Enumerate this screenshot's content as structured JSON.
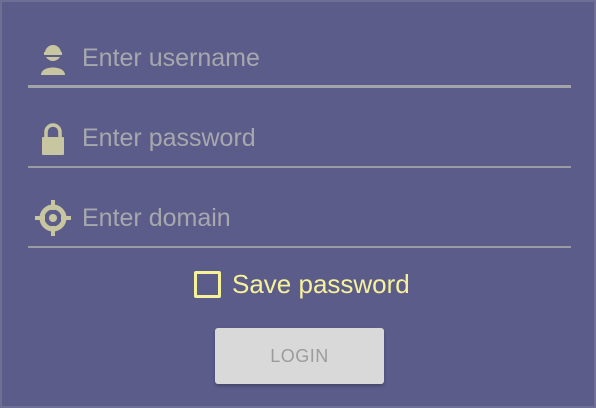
{
  "form": {
    "username": {
      "placeholder": "Enter username",
      "value": "",
      "icon": "user-icon"
    },
    "password": {
      "placeholder": "Enter password",
      "value": "",
      "icon": "lock-icon"
    },
    "domain": {
      "placeholder": "Enter domain",
      "value": "",
      "icon": "crosshair-icon"
    },
    "save_password": {
      "label": "Save password",
      "checked": false
    },
    "login_label": "LOGIN"
  },
  "colors": {
    "background": "#5c5c8a",
    "icon": "#c8c6a0",
    "placeholder": "#a7a7ae",
    "checkbox_accent": "#f6f19b",
    "button_bg": "#d9d9d9",
    "button_text": "#9c9c9c"
  }
}
